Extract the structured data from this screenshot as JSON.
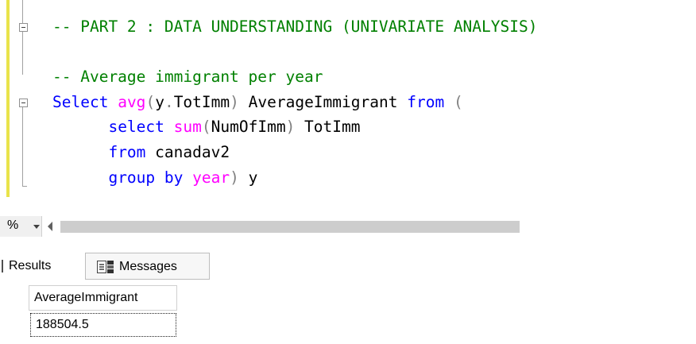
{
  "editor": {
    "lines": [
      [
        {
          "t": "-- PART 2 : DATA UNDERSTANDING (UNIVARIATE ANALYSIS)",
          "c": "comment"
        }
      ],
      [],
      [
        {
          "t": "-- Average immigrant per year",
          "c": "comment"
        }
      ],
      [
        {
          "t": "Select",
          "c": "kw"
        },
        {
          "t": " ",
          "c": "plain"
        },
        {
          "t": "avg",
          "c": "fn"
        },
        {
          "t": "(",
          "c": "gray"
        },
        {
          "t": "y",
          "c": "plain"
        },
        {
          "t": ".",
          "c": "gray"
        },
        {
          "t": "TotImm",
          "c": "plain"
        },
        {
          "t": ")",
          "c": "gray"
        },
        {
          "t": " AverageImmigrant ",
          "c": "plain"
        },
        {
          "t": "from",
          "c": "kw"
        },
        {
          "t": " ",
          "c": "plain"
        },
        {
          "t": "(",
          "c": "gray"
        }
      ],
      [
        {
          "t": "      ",
          "c": "plain"
        },
        {
          "t": "select",
          "c": "kw"
        },
        {
          "t": " ",
          "c": "plain"
        },
        {
          "t": "sum",
          "c": "fn"
        },
        {
          "t": "(",
          "c": "gray"
        },
        {
          "t": "NumOfImm",
          "c": "plain"
        },
        {
          "t": ")",
          "c": "gray"
        },
        {
          "t": " TotImm",
          "c": "plain"
        }
      ],
      [
        {
          "t": "      ",
          "c": "plain"
        },
        {
          "t": "from",
          "c": "kw"
        },
        {
          "t": " canadav2",
          "c": "plain"
        }
      ],
      [
        {
          "t": "      ",
          "c": "plain"
        },
        {
          "t": "group",
          "c": "kw"
        },
        {
          "t": " ",
          "c": "plain"
        },
        {
          "t": "by",
          "c": "kw"
        },
        {
          "t": " ",
          "c": "plain"
        },
        {
          "t": "year",
          "c": "fn"
        },
        {
          "t": ")",
          "c": "gray"
        },
        {
          "t": " y",
          "c": "plain"
        }
      ]
    ]
  },
  "zoom": {
    "value": "%"
  },
  "tabs": {
    "results_label": "Results",
    "messages_label": "Messages"
  },
  "grid": {
    "columns": [
      "AverageImmigrant"
    ],
    "rows": [
      [
        "188504.5"
      ]
    ]
  }
}
